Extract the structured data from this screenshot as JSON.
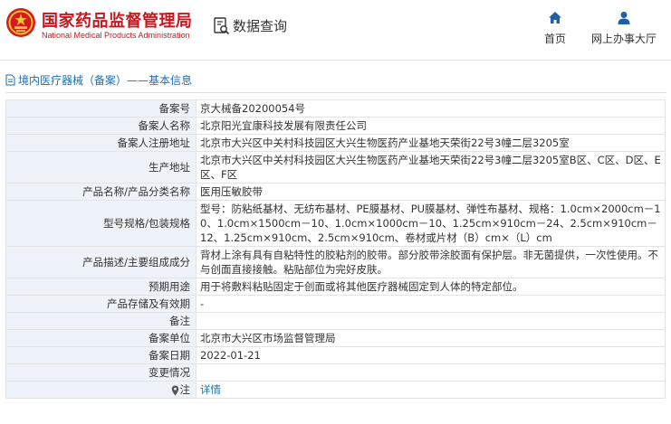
{
  "header": {
    "org_name_cn": "国家药品监督管理局",
    "org_name_en": "National Medical Products Administration",
    "query_label": "数据查询",
    "nav": [
      {
        "label": "首页",
        "icon": "home-icon"
      },
      {
        "label": "网上办事大厅",
        "icon": "user-icon"
      }
    ]
  },
  "breadcrumb": "境内医疗器械（备案）——基本信息",
  "rows": [
    {
      "key": "备案号",
      "value": "京大械备20200054号"
    },
    {
      "key": "备案人名称",
      "value": "北京阳光宜康科技发展有限责任公司"
    },
    {
      "key": "备案人注册地址",
      "value": "北京市大兴区中关村科技园区大兴生物医药产业基地天荣街22号3幢二层3205室"
    },
    {
      "key": "生产地址",
      "value": "北京市大兴区中关村科技园区大兴生物医药产业基地天荣街22号3幢二层3205室B区、C区、D区、E区、F区"
    },
    {
      "key": "产品名称/产品分类名称",
      "value": "医用压敏胶带"
    },
    {
      "key": "型号规格/包装规格",
      "value": "型号：防粘纸基材、无纺布基材、PE膜基材、PU膜基材、弹性布基材、规格：1.0cm×2000cm－10、1.0cm×1500cm－10、1.0cm×1000cm－10、1.25cm×910cm－24、2.5cm×910cm－12、1.25cm×910cm、2.5cm×910cm、卷材或片材（B）cm×（L）cm"
    },
    {
      "key": "产品描述/主要组成成分",
      "value": "背材上涂有具有自粘特性的胶粘剂的胶带。部分胶带涂胶面有保护层。非无菌提供，一次性使用。不与创面直接接触。粘贴部位为完好皮肤。"
    },
    {
      "key": "预期用途",
      "value": "用于将敷料粘贴固定于创面或将其他医疗器械固定到人体的特定部位。"
    },
    {
      "key": "产品存储及有效期",
      "value": "-"
    },
    {
      "key": "备注",
      "value": ""
    },
    {
      "key": "备案单位",
      "value": "北京市大兴区市场监督管理局"
    },
    {
      "key": "备案日期",
      "value": "2022-01-21"
    },
    {
      "key": "变更情况",
      "value": ""
    },
    {
      "key": "注",
      "value": "详情"
    }
  ],
  "colors": {
    "brand_red": "#c8161d",
    "link_blue": "#1a6fb5",
    "key_bg": "#eef3f9",
    "nav_icon_blue": "#1e5fa8"
  }
}
